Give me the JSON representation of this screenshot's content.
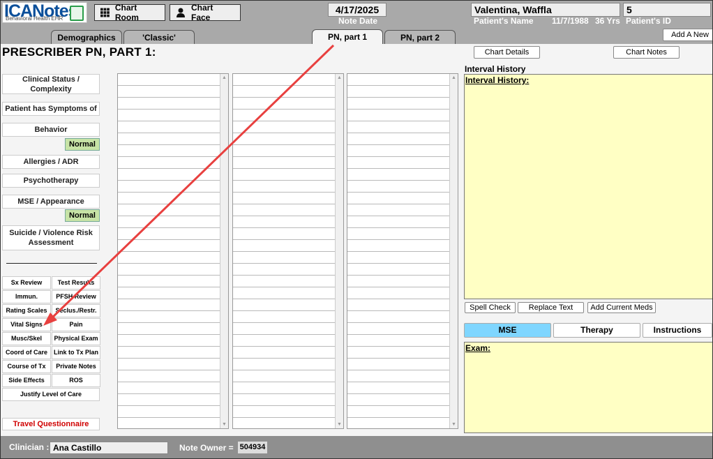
{
  "logo": {
    "text": "ICANotes",
    "subtext": "Behavioral Health EHR"
  },
  "toolbar": {
    "chart_room": "Chart Room",
    "chart_face": "Chart Face"
  },
  "header": {
    "note_date_value": "4/17/2025",
    "note_date_label": "Note Date",
    "patient_name": "Valentina, Waffla",
    "patient_name_label": "Patient's Name",
    "patient_dob": "11/7/1988",
    "patient_age": "36 Yrs",
    "patient_id": "5",
    "patient_id_label": "Patient's ID",
    "add_new": "Add A New"
  },
  "tabs": {
    "demographics": "Demographics",
    "classic": "'Classic'",
    "pn_part1": "PN, part 1",
    "pn_part2": "PN, part 2"
  },
  "page": {
    "title": "PRESCRIBER PN, PART 1:"
  },
  "buttons": {
    "chart_details": "Chart Details",
    "chart_notes": "Chart Notes"
  },
  "left_sections": {
    "clinical_status": "Clinical Status / Complexity",
    "patient_symptoms": "Patient has Symptoms of",
    "behavior": "Behavior",
    "behavior_normal": "Normal",
    "allergies": "Allergies / ADR",
    "psychotherapy": "Psychotherapy",
    "mse_appearance": "MSE / Appearance",
    "mse_normal": "Normal",
    "suicide_risk": "Suicide / Violence Risk Assessment"
  },
  "grid_buttons": [
    [
      "Sx Review",
      "Test Results"
    ],
    [
      "Immun.",
      "PFSH Review"
    ],
    [
      "Rating Scales",
      "Seclus./Restr."
    ],
    [
      "Vital Signs",
      "Pain"
    ],
    [
      "Musc/Skel",
      "Physical Exam"
    ],
    [
      "Coord of Care",
      "Link to Tx Plan"
    ],
    [
      "Course of Tx",
      "Private Notes"
    ],
    [
      "Side Effects",
      "ROS"
    ]
  ],
  "justify": "Justify Level of Care",
  "travel": "Travel Questionnaire",
  "interval": {
    "heading": "Interval History",
    "field_label": "Interval History:",
    "spell_check": "Spell Check",
    "replace_text": "Replace Text",
    "add_meds": "Add Current Meds"
  },
  "panel_tabs": {
    "mse": "MSE",
    "therapy": "Therapy",
    "instructions": "Instructions"
  },
  "exam": {
    "label": "Exam:"
  },
  "footer": {
    "clinician_label": "Clinician :",
    "clinician_value": "Ana Castillo",
    "owner_label": "Note Owner =",
    "owner_value": "504934"
  },
  "colors": {
    "accent_tab": "#7fd6ff",
    "yellow_field": "#ffffc4",
    "normal_badge": "#c7e3a6",
    "annotation_arrow": "#e8403f"
  }
}
